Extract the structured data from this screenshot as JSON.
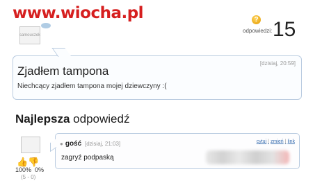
{
  "watermark": "www.wiocha.pl",
  "question": {
    "avatar_text": "samouczek",
    "answers_label": "odpowiedzi:",
    "answers_count": "15",
    "time": "[dzisiaj, 20:59]",
    "title": "Zjadłem tampona",
    "body": "Niechcący zjadłem tampona mojej dziewczyny :("
  },
  "best_answer": {
    "header_bold": "Najlepsza",
    "header_rest": " odpowiedź",
    "author": "gość",
    "time": "[dzisiaj, 21:03]",
    "links": [
      "cytuj",
      "zmień",
      "link"
    ],
    "text": "zagryź podpaską",
    "vote_up_percent": "100%",
    "vote_down_percent": "0%",
    "vote_counts": "(5 - 0)"
  },
  "colors": {
    "watermark": "#d61f1f",
    "box_border": "#b9cbe0",
    "link": "#3a6fb0"
  }
}
